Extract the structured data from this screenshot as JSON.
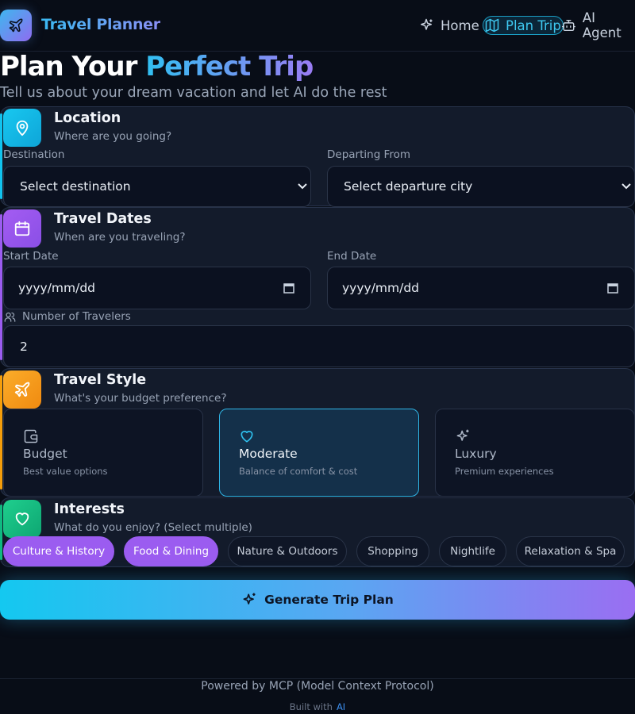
{
  "header": {
    "brand": "Travel Planner",
    "nav": [
      {
        "label": "Home",
        "icon": "sparkles-icon"
      },
      {
        "label": "Plan Trip",
        "icon": "map-icon",
        "active": true
      },
      {
        "label": "AI Agent",
        "icon": "bot-icon"
      }
    ]
  },
  "hero": {
    "title_plain": "Plan Your ",
    "title_highlight": "Perfect Trip",
    "subtitle": "Tell us about your dream vacation and let AI do the rest"
  },
  "location": {
    "title": "Location",
    "subtitle": "Where are you going?",
    "destination_label": "Destination",
    "destination_value": "Select destination",
    "departure_label": "Departing From",
    "departure_value": "Select departure city"
  },
  "dates": {
    "title": "Travel Dates",
    "subtitle": "When are you traveling?",
    "start_label": "Start Date",
    "start_value": "yyyy/mm/dd",
    "end_label": "End Date",
    "end_value": "yyyy/mm/dd",
    "travelers_label": "Number of Travelers",
    "travelers_value": "2"
  },
  "style": {
    "title": "Travel Style",
    "subtitle": "What's your budget preference?",
    "options": [
      {
        "name": "Budget",
        "desc": "Best value options",
        "icon": "wallet-icon",
        "selected": false
      },
      {
        "name": "Moderate",
        "desc": "Balance of comfort & cost",
        "icon": "heart-icon",
        "selected": true
      },
      {
        "name": "Luxury",
        "desc": "Premium experiences",
        "icon": "sparkles-icon",
        "selected": false
      }
    ]
  },
  "interests": {
    "title": "Interests",
    "subtitle": "What do you enjoy? (Select multiple)",
    "chips": [
      {
        "label": "Culture & History",
        "selected": true
      },
      {
        "label": "Food & Dining",
        "selected": true
      },
      {
        "label": "Nature & Outdoors",
        "selected": false
      },
      {
        "label": "Shopping",
        "selected": false
      },
      {
        "label": "Nightlife",
        "selected": false
      },
      {
        "label": "Relaxation & Spa",
        "selected": false
      }
    ]
  },
  "actions": {
    "generate_label": "Generate Trip Plan"
  },
  "footer": {
    "powered": "Powered by MCP (Model Context Protocol)",
    "built_with": "Built with",
    "built_ai": "AI"
  },
  "colors": {
    "background": "#080d17",
    "accent_cyan": "#14c8f0",
    "accent_purple": "#9b5cf0",
    "location_accent": "#11c3ee",
    "dates_accent": "#9b5cf0",
    "style_accent": "#f59e0b",
    "interests_accent": "#10b981"
  }
}
